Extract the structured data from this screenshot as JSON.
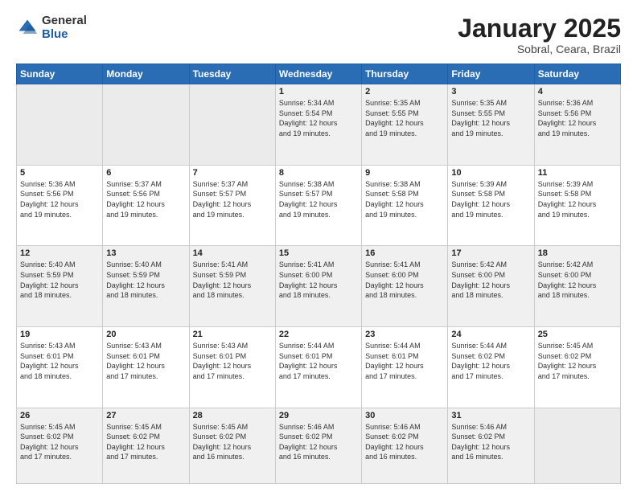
{
  "logo": {
    "general": "General",
    "blue": "Blue"
  },
  "title": "January 2025",
  "subtitle": "Sobral, Ceara, Brazil",
  "days": [
    "Sunday",
    "Monday",
    "Tuesday",
    "Wednesday",
    "Thursday",
    "Friday",
    "Saturday"
  ],
  "weeks": [
    [
      {
        "num": "",
        "info": ""
      },
      {
        "num": "",
        "info": ""
      },
      {
        "num": "",
        "info": ""
      },
      {
        "num": "1",
        "info": "Sunrise: 5:34 AM\nSunset: 5:54 PM\nDaylight: 12 hours\nand 19 minutes."
      },
      {
        "num": "2",
        "info": "Sunrise: 5:35 AM\nSunset: 5:55 PM\nDaylight: 12 hours\nand 19 minutes."
      },
      {
        "num": "3",
        "info": "Sunrise: 5:35 AM\nSunset: 5:55 PM\nDaylight: 12 hours\nand 19 minutes."
      },
      {
        "num": "4",
        "info": "Sunrise: 5:36 AM\nSunset: 5:56 PM\nDaylight: 12 hours\nand 19 minutes."
      }
    ],
    [
      {
        "num": "5",
        "info": "Sunrise: 5:36 AM\nSunset: 5:56 PM\nDaylight: 12 hours\nand 19 minutes."
      },
      {
        "num": "6",
        "info": "Sunrise: 5:37 AM\nSunset: 5:56 PM\nDaylight: 12 hours\nand 19 minutes."
      },
      {
        "num": "7",
        "info": "Sunrise: 5:37 AM\nSunset: 5:57 PM\nDaylight: 12 hours\nand 19 minutes."
      },
      {
        "num": "8",
        "info": "Sunrise: 5:38 AM\nSunset: 5:57 PM\nDaylight: 12 hours\nand 19 minutes."
      },
      {
        "num": "9",
        "info": "Sunrise: 5:38 AM\nSunset: 5:58 PM\nDaylight: 12 hours\nand 19 minutes."
      },
      {
        "num": "10",
        "info": "Sunrise: 5:39 AM\nSunset: 5:58 PM\nDaylight: 12 hours\nand 19 minutes."
      },
      {
        "num": "11",
        "info": "Sunrise: 5:39 AM\nSunset: 5:58 PM\nDaylight: 12 hours\nand 19 minutes."
      }
    ],
    [
      {
        "num": "12",
        "info": "Sunrise: 5:40 AM\nSunset: 5:59 PM\nDaylight: 12 hours\nand 18 minutes."
      },
      {
        "num": "13",
        "info": "Sunrise: 5:40 AM\nSunset: 5:59 PM\nDaylight: 12 hours\nand 18 minutes."
      },
      {
        "num": "14",
        "info": "Sunrise: 5:41 AM\nSunset: 5:59 PM\nDaylight: 12 hours\nand 18 minutes."
      },
      {
        "num": "15",
        "info": "Sunrise: 5:41 AM\nSunset: 6:00 PM\nDaylight: 12 hours\nand 18 minutes."
      },
      {
        "num": "16",
        "info": "Sunrise: 5:41 AM\nSunset: 6:00 PM\nDaylight: 12 hours\nand 18 minutes."
      },
      {
        "num": "17",
        "info": "Sunrise: 5:42 AM\nSunset: 6:00 PM\nDaylight: 12 hours\nand 18 minutes."
      },
      {
        "num": "18",
        "info": "Sunrise: 5:42 AM\nSunset: 6:00 PM\nDaylight: 12 hours\nand 18 minutes."
      }
    ],
    [
      {
        "num": "19",
        "info": "Sunrise: 5:43 AM\nSunset: 6:01 PM\nDaylight: 12 hours\nand 18 minutes."
      },
      {
        "num": "20",
        "info": "Sunrise: 5:43 AM\nSunset: 6:01 PM\nDaylight: 12 hours\nand 17 minutes."
      },
      {
        "num": "21",
        "info": "Sunrise: 5:43 AM\nSunset: 6:01 PM\nDaylight: 12 hours\nand 17 minutes."
      },
      {
        "num": "22",
        "info": "Sunrise: 5:44 AM\nSunset: 6:01 PM\nDaylight: 12 hours\nand 17 minutes."
      },
      {
        "num": "23",
        "info": "Sunrise: 5:44 AM\nSunset: 6:01 PM\nDaylight: 12 hours\nand 17 minutes."
      },
      {
        "num": "24",
        "info": "Sunrise: 5:44 AM\nSunset: 6:02 PM\nDaylight: 12 hours\nand 17 minutes."
      },
      {
        "num": "25",
        "info": "Sunrise: 5:45 AM\nSunset: 6:02 PM\nDaylight: 12 hours\nand 17 minutes."
      }
    ],
    [
      {
        "num": "26",
        "info": "Sunrise: 5:45 AM\nSunset: 6:02 PM\nDaylight: 12 hours\nand 17 minutes."
      },
      {
        "num": "27",
        "info": "Sunrise: 5:45 AM\nSunset: 6:02 PM\nDaylight: 12 hours\nand 17 minutes."
      },
      {
        "num": "28",
        "info": "Sunrise: 5:45 AM\nSunset: 6:02 PM\nDaylight: 12 hours\nand 16 minutes."
      },
      {
        "num": "29",
        "info": "Sunrise: 5:46 AM\nSunset: 6:02 PM\nDaylight: 12 hours\nand 16 minutes."
      },
      {
        "num": "30",
        "info": "Sunrise: 5:46 AM\nSunset: 6:02 PM\nDaylight: 12 hours\nand 16 minutes."
      },
      {
        "num": "31",
        "info": "Sunrise: 5:46 AM\nSunset: 6:02 PM\nDaylight: 12 hours\nand 16 minutes."
      },
      {
        "num": "",
        "info": ""
      }
    ]
  ]
}
